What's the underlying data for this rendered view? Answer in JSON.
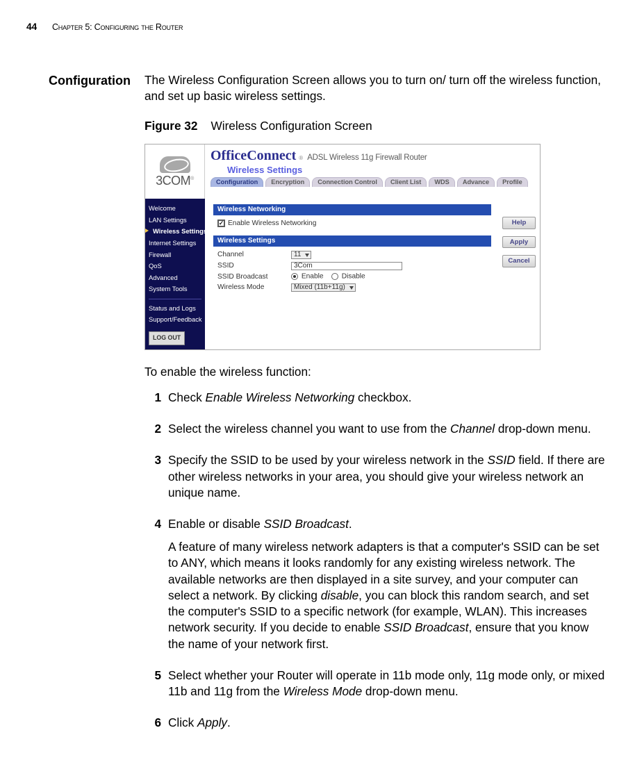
{
  "header": {
    "page_number": "44",
    "chapter": "Chapter 5: Configuring the Router"
  },
  "section_heading": "Configuration",
  "intro": "The Wireless Configuration Screen allows you to turn on/ turn off the wireless function, and set up basic wireless settings.",
  "figure": {
    "label": "Figure 32",
    "caption": "Wireless Configuration Screen"
  },
  "screenshot": {
    "brand_logo_text": "3COM",
    "brand_line1a": "Office",
    "brand_line1b": "Connect",
    "product": "ADSL Wireless 11g Firewall Router",
    "subtitle": "Wireless Settings",
    "tabs": [
      "Configuration",
      "Encryption",
      "Connection Control",
      "Client List",
      "WDS",
      "Advance",
      "Profile"
    ],
    "tab_active_index": 0,
    "side_items": [
      "Welcome",
      "LAN Settings",
      "Wireless Settings",
      "Internet Settings",
      "Firewall",
      "QoS",
      "Advanced",
      "System Tools"
    ],
    "side_items2": [
      "Status and Logs",
      "Support/Feedback"
    ],
    "side_selected_index": 2,
    "logout": "LOG OUT",
    "section1": "Wireless Networking",
    "enable_label": "Enable Wireless Networking",
    "enable_checked": true,
    "section2": "Wireless Settings",
    "rows": {
      "channel": {
        "label": "Channel",
        "value": "11"
      },
      "ssid": {
        "label": "SSID",
        "value": "3Com"
      },
      "ssid_broadcast": {
        "label": "SSID Broadcast",
        "opt1": "Enable",
        "opt2": "Disable"
      },
      "mode": {
        "label": "Wireless Mode",
        "value": "Mixed (11b+11g)"
      }
    },
    "buttons": {
      "help": "Help",
      "apply": "Apply",
      "cancel": "Cancel"
    }
  },
  "lead": "To enable the wireless function:",
  "steps": [
    {
      "parts": [
        {
          "t": "Check "
        },
        {
          "t": "Enable Wireless Networking",
          "i": true
        },
        {
          "t": " checkbox."
        }
      ]
    },
    {
      "parts": [
        {
          "t": "Select the wireless channel you want to use from the "
        },
        {
          "t": "Channel",
          "i": true
        },
        {
          "t": " drop-down menu."
        }
      ]
    },
    {
      "parts": [
        {
          "t": "Specify the SSID to be used by your wireless network in the "
        },
        {
          "t": "SSID",
          "i": true
        },
        {
          "t": " field. If there are other wireless networks in your area, you should give your wireless network an unique name."
        }
      ]
    },
    {
      "parts": [
        {
          "t": "Enable or disable "
        },
        {
          "t": "SSID Broadcast",
          "i": true
        },
        {
          "t": "."
        }
      ],
      "para2": [
        {
          "t": "A feature of many wireless network adapters is that a computer's SSID can be set to ANY, which means it looks randomly for any existing wireless network. The available networks are then displayed in a site survey, and your computer can select a network. By clicking "
        },
        {
          "t": "disable",
          "i": true
        },
        {
          "t": ", you can block this random search, and set the computer's SSID to a specific network (for example, WLAN). This increases network security. If you decide to enable "
        },
        {
          "t": "SSID Broadcast",
          "i": true
        },
        {
          "t": ", ensure that you know the name of your network first."
        }
      ]
    },
    {
      "parts": [
        {
          "t": "Select whether your Router will operate in 11b mode only, 11g mode only, or mixed 11b and 11g from the "
        },
        {
          "t": "Wireless Mode",
          "i": true
        },
        {
          "t": " drop-down menu."
        }
      ]
    },
    {
      "parts": [
        {
          "t": "Click "
        },
        {
          "t": "Apply",
          "i": true
        },
        {
          "t": "."
        }
      ]
    }
  ]
}
